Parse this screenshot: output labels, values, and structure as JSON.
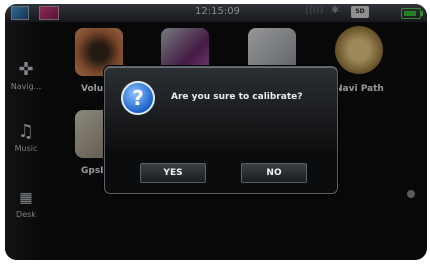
{
  "status_bar": {
    "time": "12:15:09",
    "sd_label": "SD"
  },
  "sidebar": {
    "items": [
      {
        "icon": "crosshair-icon",
        "label": "Navig..."
      },
      {
        "icon": "music-note-icon",
        "label": "Music"
      },
      {
        "icon": "grid-icon",
        "label": "Desk"
      }
    ]
  },
  "apps": [
    {
      "name": "volume-app",
      "label": "Volu"
    },
    {
      "name": "app-2",
      "label": ""
    },
    {
      "name": "app-3",
      "label": ""
    },
    {
      "name": "navi-path-app",
      "label": "Navi Path"
    },
    {
      "name": "gps-app",
      "label": "GpsI"
    }
  ],
  "dialog": {
    "message": "Are you sure to calibrate?",
    "yes_label": "YES",
    "no_label": "NO"
  }
}
